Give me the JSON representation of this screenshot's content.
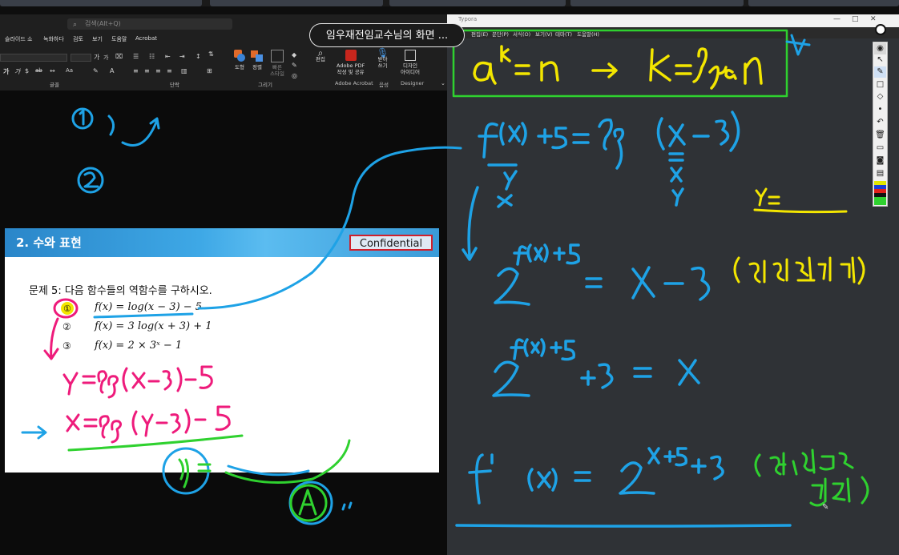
{
  "meeting": {
    "share_banner": "임우재전임교수님의 화면 ...",
    "colors": {
      "ink_blue": "#1ea2e6",
      "ink_yellow": "#f3e600",
      "ink_pink": "#ee1b7b",
      "ink_green": "#2fd12f"
    }
  },
  "ppt": {
    "search_placeholder": "검색(Alt+Q)",
    "menu": [
      "슬라이드 쇼",
      "녹화하다",
      "검토",
      "보기",
      "도움말",
      "Acrobat"
    ],
    "groups": [
      "글꼴",
      "단락",
      "그리기",
      "Adobe Acrobat",
      "음성",
      "Designer"
    ],
    "buttons": {
      "shapes": "도형",
      "arrange": "정렬",
      "quick_styles": "빠른\n스타일",
      "edit": "편집",
      "adobe_pdf": "Adobe PDF\n작성 및 공유",
      "dictate": "받아\n쓰기",
      "designer": "디자인\n아이디어"
    },
    "font_glyphs": {
      "size_up": "가",
      "size_down": "가",
      "bold": "가",
      "italic": "가",
      "dollar": "$",
      "strike": "ab",
      "case": "Aa"
    }
  },
  "slide": {
    "title": "2. 수와 표현",
    "badge": "Confidential",
    "question": "문제 5: 다음 함수들의 역함수를 구하시오.",
    "items": [
      {
        "num": "①",
        "fx": "f(x) = log(x − 3) − 5"
      },
      {
        "num": "②",
        "fx": "f(x) = 3 log(x + 3) + 1"
      },
      {
        "num": "③",
        "fx": "f(x) = 2 × 3ˣ − 1"
      }
    ]
  },
  "whiteboard": {
    "title": "Typora",
    "menu": [
      "편집(E)",
      "문단(P)",
      "서식(O)",
      "보기(V)",
      "테마(T)",
      "도움말(H)"
    ],
    "window_buttons": [
      "—",
      "□",
      "✕"
    ]
  },
  "annotation_tools": {
    "icons": [
      "eye-icon",
      "cursor-icon",
      "pen-icon",
      "rectangle-icon",
      "eraser-icon",
      "dot-icon",
      "undo-icon",
      "trash-icon",
      "monitor-icon",
      "camera-icon",
      "clipboard-icon"
    ],
    "swatches": [
      "#e2e600",
      "#1a3ed8",
      "#e0201a",
      "#111111",
      "#2fd12f"
    ]
  }
}
